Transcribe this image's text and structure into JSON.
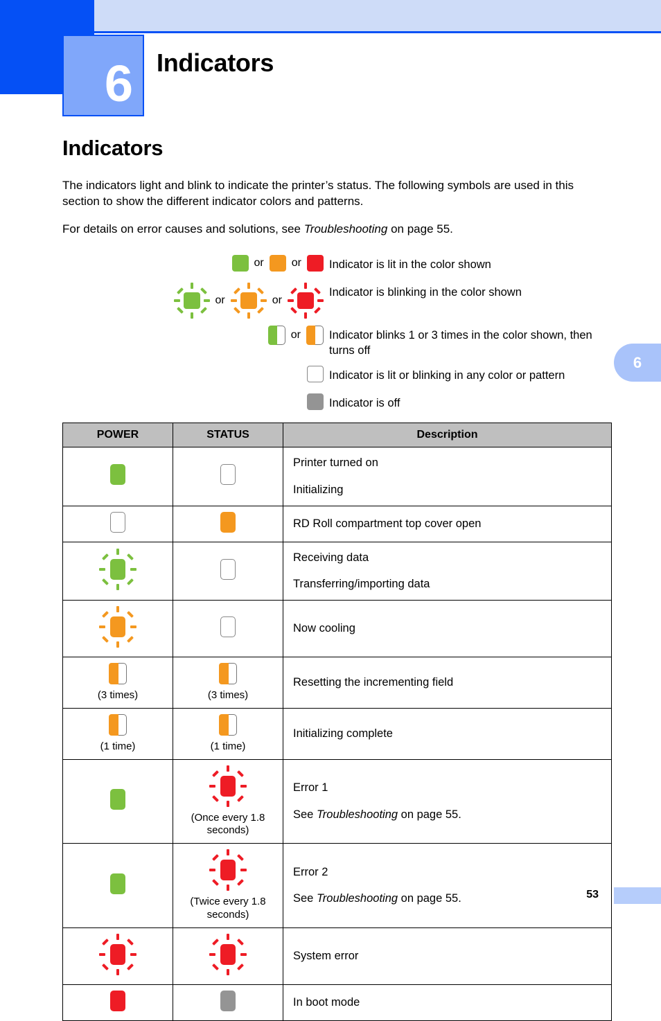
{
  "header": {
    "chapter_number": "6",
    "chapter_title": "Indicators",
    "tab_number": "6"
  },
  "section": {
    "title": "Indicators",
    "paragraph_1": "The indicators light and blink to indicate the printer’s status. The following symbols are used in this section to show the different indicator colors and patterns.",
    "paragraph_2_prefix": "For details on error causes and solutions, see ",
    "paragraph_2_italic": "Troubleshooting",
    "paragraph_2_suffix": " on page 55."
  },
  "legend": {
    "or_label": "or",
    "rows": [
      {
        "text": "Indicator is lit in the color shown"
      },
      {
        "text": "Indicator is blinking in the color shown"
      },
      {
        "text": "Indicator blinks 1 or 3 times in the color shown, then turns off"
      },
      {
        "text": "Indicator is lit or blinking in any color or pattern"
      },
      {
        "text": "Indicator is off"
      }
    ]
  },
  "table": {
    "headers": {
      "power": "POWER",
      "status": "STATUS",
      "description": "Description"
    },
    "rows": [
      {
        "power_caption": "",
        "status_caption": "",
        "desc_lines": [
          "Printer turned on",
          "Initializing"
        ]
      },
      {
        "power_caption": "",
        "status_caption": "",
        "desc_lines": [
          "RD Roll compartment top cover open"
        ]
      },
      {
        "power_caption": "",
        "status_caption": "",
        "desc_lines": [
          "Receiving data",
          "Transferring/importing data"
        ]
      },
      {
        "power_caption": "",
        "status_caption": "",
        "desc_lines": [
          "Now cooling"
        ]
      },
      {
        "power_caption": "(3 times)",
        "status_caption": "(3 times)",
        "desc_lines": [
          "Resetting the incrementing field"
        ]
      },
      {
        "power_caption": "(1 time)",
        "status_caption": "(1 time)",
        "desc_lines": [
          "Initializing complete"
        ]
      },
      {
        "power_caption": "",
        "status_caption": "(Once every 1.8 seconds)",
        "desc_lines": [
          "Error 1"
        ],
        "desc_ref_prefix": "See ",
        "desc_ref_italic": "Troubleshooting",
        "desc_ref_suffix": " on page 55."
      },
      {
        "power_caption": "",
        "status_caption": "(Twice every 1.8 seconds)",
        "desc_lines": [
          "Error 2"
        ],
        "desc_ref_prefix": "See ",
        "desc_ref_italic": "Troubleshooting",
        "desc_ref_suffix": " on page 55."
      },
      {
        "power_caption": "",
        "status_caption": "",
        "desc_lines": [
          "System error"
        ]
      },
      {
        "power_caption": "",
        "status_caption": "",
        "desc_lines": [
          "In boot mode"
        ]
      }
    ]
  },
  "footer": {
    "page_number": "53"
  },
  "colors": {
    "green": "#7cc03f",
    "orange": "#f4981f",
    "red": "#ee1c25",
    "gray_off": "#949494",
    "brand_blue": "#0550f5",
    "brand_blue_light": "#cedcf8",
    "brand_blue_mid": "#80a7fa",
    "table_header_gray": "#bfbfbf"
  }
}
